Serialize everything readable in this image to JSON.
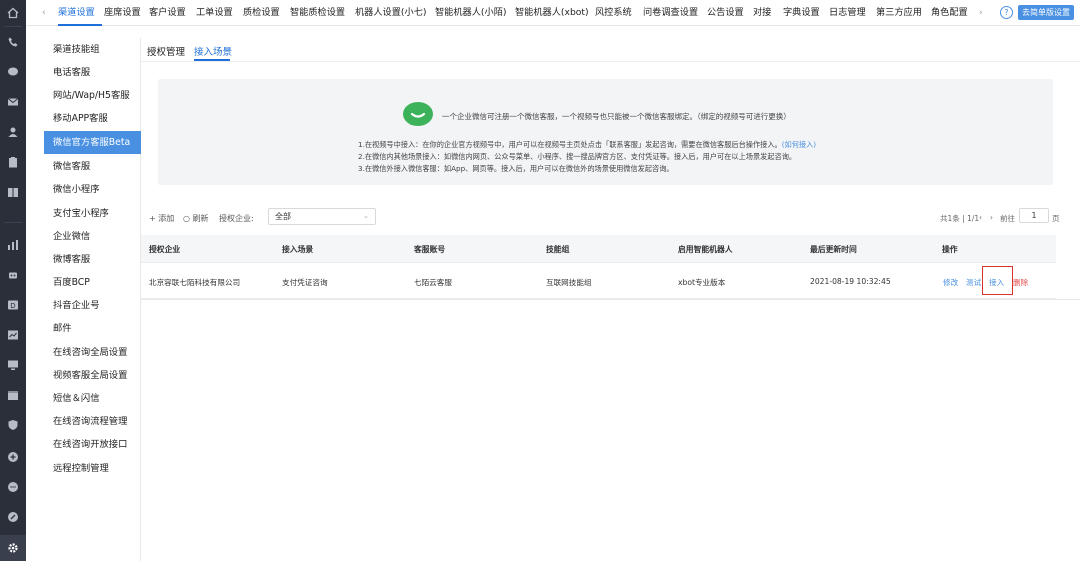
{
  "topnav": {
    "items": [
      "渠道设置",
      "座席设置",
      "客户设置",
      "工单设置",
      "质检设置",
      "智能质检设置",
      "机器人设置(小七)",
      "智能机器人(小陌)",
      "智能机器人(xbot)",
      "风控系统",
      "问卷调查设置",
      "公告设置",
      "对接",
      "字典设置",
      "日志管理",
      "第三方应用",
      "角色配置"
    ],
    "active": "渠道设置",
    "help": "?",
    "simple_mode_button": "去简单版设置"
  },
  "sidebar": {
    "items": [
      "渠道技能组",
      "电话客服",
      "网站/Wap/H5客服",
      "移动APP客服",
      "微信官方客服Beta",
      "微信客服",
      "微信小程序",
      "支付宝小程序",
      "企业微信",
      "微博客服",
      "百度BCP",
      "抖音企业号",
      "邮件",
      "在线咨询全局设置",
      "视频客服全局设置",
      "短信＆闪信",
      "在线咨询流程管理",
      "在线咨询开放接口",
      "远程控制管理"
    ],
    "active": "微信官方客服Beta"
  },
  "tabs": [
    "授权管理",
    "接入场景"
  ],
  "active_tab": "接入场景",
  "info": {
    "headline": "一个企业微信可注册一个微信客服，一个视频号也只能被一个微信客服绑定。（绑定的视频号可进行更换）",
    "line1": "1.在视频号中接入：在你的企业官方视频号中，用户可以在视频号主页处点击「联系客服」发起咨询，需要在微信客服后台操作接入。",
    "line1_link": "(如何接入)",
    "line2": "2.在微信内其他场景接入：如微信内网页、公众号菜单、小程序、搜一搜品牌官方区、支付凭证等。接入后，用户可在以上场景发起咨询。",
    "line3": "3.在微信外接入微信客服：如App、网页等。接入后，用户可以在微信外的场景使用微信发起咨询。"
  },
  "toolbar": {
    "add": "+ 添加",
    "refresh": "○ 刷新",
    "enterprise_label": "授权企业:",
    "enterprise_value": "全部"
  },
  "pager": {
    "summary": "共1条 | 1/1",
    "goto_label": "前往",
    "page": "1",
    "page_unit": "页"
  },
  "table": {
    "columns": [
      "授权企业",
      "接入场景",
      "客服账号",
      "技能组",
      "启用智能机器人",
      "最后更新时间",
      "操作"
    ],
    "rows": [
      {
        "enterprise": "北京容联七陌科技有限公司",
        "scene": "支付凭证咨询",
        "account": "七陌云客服",
        "skill_group": "互联网技能组",
        "robot": "xbot专业版本",
        "updated": "2021-08-19 10:32:45",
        "actions": [
          "修改",
          "测试",
          "接入",
          "删除"
        ]
      }
    ]
  },
  "colors": {
    "accent": "#1e6fd9",
    "active_bg": "#4a90e2",
    "danger": "#e64d4d",
    "highlight_box": "#d9342b",
    "rail": "#2b2f3a"
  }
}
